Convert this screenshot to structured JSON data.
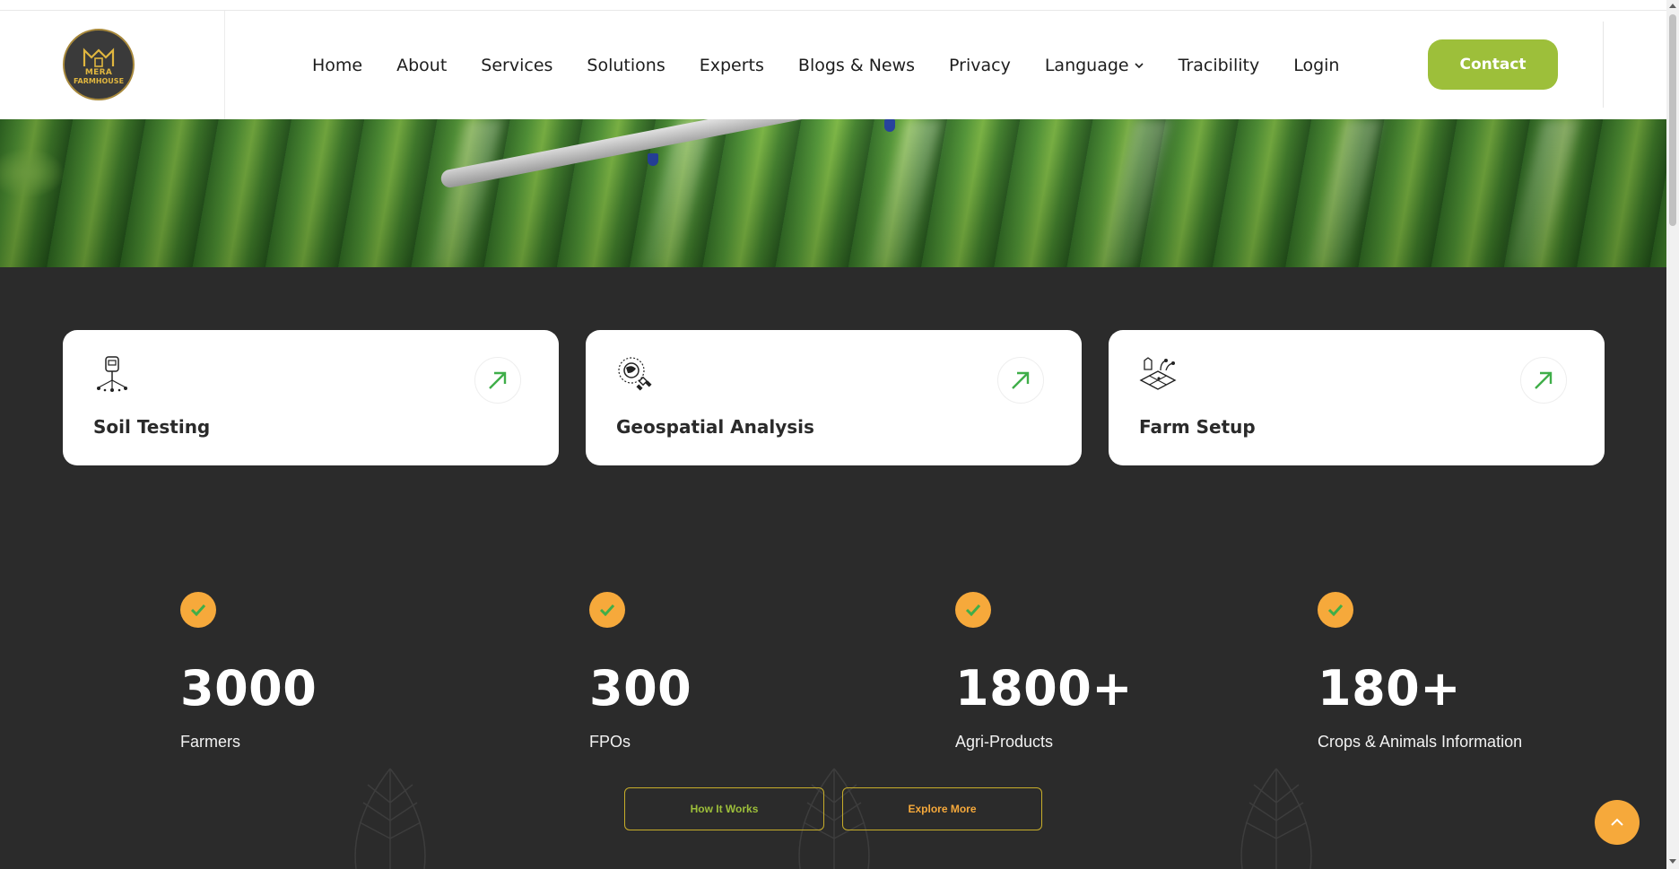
{
  "logo": {
    "line1": "MERA",
    "line2": "FARMHOUSE"
  },
  "nav": {
    "items": [
      "Home",
      "About",
      "Services",
      "Solutions",
      "Experts",
      "Blogs & News",
      "Privacy",
      "Language",
      "Tracibility",
      "Login"
    ],
    "contact_label": "Contact"
  },
  "services": [
    {
      "title": "Soil Testing",
      "icon": "soil-probe-icon"
    },
    {
      "title": "Geospatial Analysis",
      "icon": "satellite-globe-icon"
    },
    {
      "title": "Farm Setup",
      "icon": "farm-plot-icon"
    }
  ],
  "stats": [
    {
      "value": "3000",
      "label": "Farmers"
    },
    {
      "value": "300",
      "label": "FPOs"
    },
    {
      "value": "1800+",
      "label": "Agri-Products"
    },
    {
      "value": "180+",
      "label": "Crops & Animals Information"
    }
  ],
  "buttons": {
    "how_it_works": "How It Works",
    "explore_more": "Explore More"
  },
  "colors": {
    "accent_green": "#9dbf3a",
    "accent_orange": "#f6a93b",
    "dark_bg": "#2b2b2b",
    "arrow_green": "#3fae49"
  }
}
